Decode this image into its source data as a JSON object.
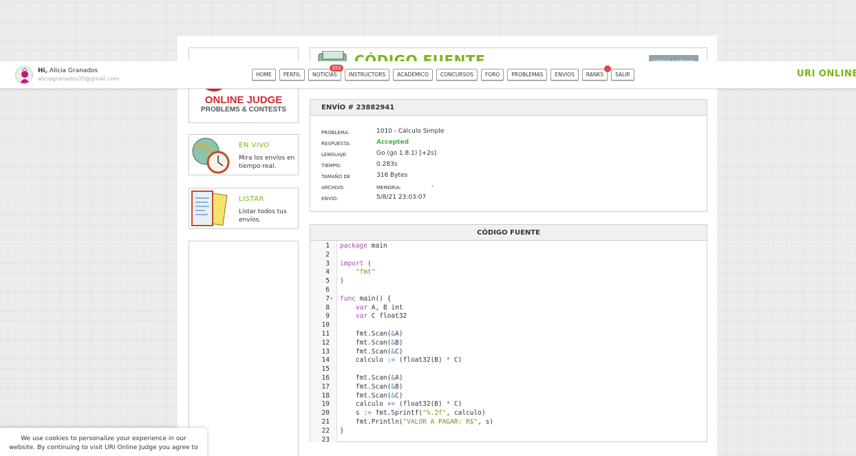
{
  "user": {
    "greeting": "Hi,",
    "name": "Alicia Granados",
    "email": "aliciagranados35@gmail.com"
  },
  "nav": [
    {
      "label": "HOME"
    },
    {
      "label": "PERFIL"
    },
    {
      "label": "NOTICIAS",
      "badge": "352"
    },
    {
      "label": "INSTRUCTORS"
    },
    {
      "label": "ACADÉMICO"
    },
    {
      "label": "CONCURSOS"
    },
    {
      "label": "FORO"
    },
    {
      "label": "PROBLEMAS"
    },
    {
      "label": "ENVIOS"
    },
    {
      "label": "RANKS",
      "dot": true
    },
    {
      "label": "SALIR"
    }
  ],
  "brand_right": "URI ONLINE J",
  "logo": {
    "title": "ONLINE JUDGE",
    "subtitle": "PROBLEMS & CONTESTS"
  },
  "sidebar": {
    "live": {
      "title": "EN VIVO",
      "desc": "Mira los envíos en tiempo real."
    },
    "list": {
      "title": "LISTAR",
      "desc": "Listar todos tus envíos."
    }
  },
  "page": {
    "title": "CÓDIGO FUENTE",
    "edit_button": "EDITAR Y ENVIAR"
  },
  "envio": {
    "header": "ENVÍO # 23882941",
    "rows": [
      {
        "label": "PROBLEMA:",
        "value": "1010 - Cálculo Simple"
      },
      {
        "label": "RESPUESTA:",
        "value": "Accepted"
      },
      {
        "label": "LENGUAJE:",
        "value": "Go (go 1.8.1) [+2s]"
      },
      {
        "label": "TIEMPO:",
        "value": "0.283s"
      },
      {
        "label": "TAMAÑO DE",
        "value": "316 Bytes"
      },
      {
        "label": "ARCHIVO:",
        "mem_label": "MEMORIA:",
        "mem_value": "-"
      },
      {
        "label": "ENVIO:",
        "value": "5/8/21 23:03:07"
      }
    ]
  },
  "code": {
    "header": "CÓDIGO FUENTE",
    "line_numbers": [
      "1",
      "2",
      "3",
      "4",
      "5",
      "6",
      "7",
      "8",
      "9",
      "10",
      "11",
      "12",
      "13",
      "14",
      "15",
      "16",
      "17",
      "18",
      "19",
      "20",
      "21",
      "22",
      "23"
    ],
    "fold_marker": "▾",
    "lines": [
      [
        {
          "t": "package",
          "c": "kw"
        },
        {
          "t": " main"
        }
      ],
      [],
      [
        {
          "t": "import",
          "c": "kw"
        },
        {
          "t": " ("
        }
      ],
      [
        {
          "t": "    "
        },
        {
          "t": "\"fmt\"",
          "c": "str"
        }
      ],
      [
        {
          "t": ")"
        }
      ],
      [],
      [
        {
          "t": "func",
          "c": "kw"
        },
        {
          "t": " main() {"
        }
      ],
      [
        {
          "t": "    "
        },
        {
          "t": "var",
          "c": "kw"
        },
        {
          "t": " A, B int"
        }
      ],
      [
        {
          "t": "    "
        },
        {
          "t": "var",
          "c": "kw"
        },
        {
          "t": " C float32"
        }
      ],
      [],
      [
        {
          "t": "    fmt.Scan("
        },
        {
          "t": "&",
          "c": "op"
        },
        {
          "t": "A)"
        }
      ],
      [
        {
          "t": "    fmt.Scan("
        },
        {
          "t": "&",
          "c": "op"
        },
        {
          "t": "B)"
        }
      ],
      [
        {
          "t": "    fmt.Scan("
        },
        {
          "t": "&",
          "c": "op"
        },
        {
          "t": "C)"
        }
      ],
      [
        {
          "t": "    calculo "
        },
        {
          "t": ":=",
          "c": "op"
        },
        {
          "t": " (float32(B) "
        },
        {
          "t": "*",
          "c": "op"
        },
        {
          "t": " C)"
        }
      ],
      [],
      [
        {
          "t": "    fmt.Scan("
        },
        {
          "t": "&",
          "c": "op"
        },
        {
          "t": "A)"
        }
      ],
      [
        {
          "t": "    fmt.Scan("
        },
        {
          "t": "&",
          "c": "op"
        },
        {
          "t": "B)"
        }
      ],
      [
        {
          "t": "    fmt.Scan("
        },
        {
          "t": "&",
          "c": "op"
        },
        {
          "t": "C)"
        }
      ],
      [
        {
          "t": "    calculo "
        },
        {
          "t": "+=",
          "c": "op"
        },
        {
          "t": " (float32(B) "
        },
        {
          "t": "*",
          "c": "op"
        },
        {
          "t": " C)"
        }
      ],
      [
        {
          "t": "    s "
        },
        {
          "t": ":=",
          "c": "op"
        },
        {
          "t": " fmt.Sprintf("
        },
        {
          "t": "\"%.2f\"",
          "c": "str"
        },
        {
          "t": ", calculo)"
        }
      ],
      [
        {
          "t": "    fmt.Println("
        },
        {
          "t": "\"VALOR A PAGAR: R$\"",
          "c": "str"
        },
        {
          "t": ", s)"
        }
      ],
      [
        {
          "t": "}"
        }
      ],
      []
    ]
  },
  "cookie": {
    "line1": "We use cookies to personalize your experience in our",
    "line2": "website. By continuing to visit URI Online Judge you agree to"
  },
  "colors": {
    "accent_green": "#7ab51d",
    "logo_red": "#d9262c",
    "badge_red": "#e0474c",
    "accepted": "#4cae4c"
  }
}
